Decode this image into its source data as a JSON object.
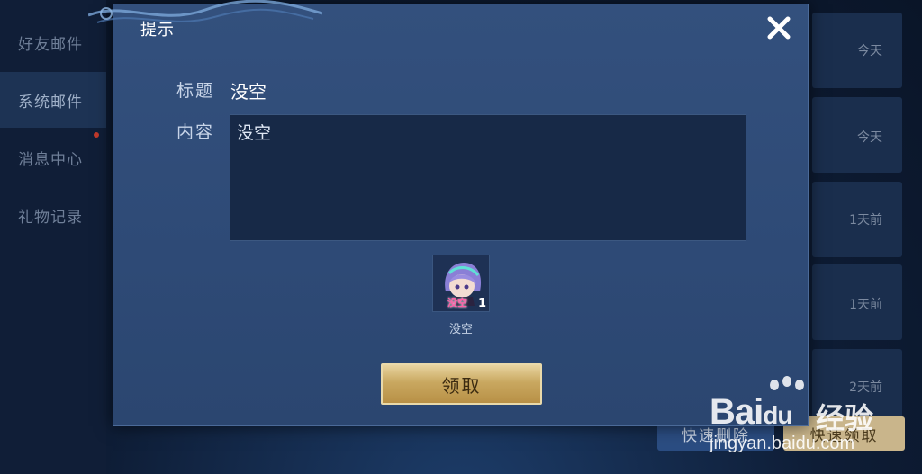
{
  "sidebar": {
    "items": [
      {
        "label": "好友邮件"
      },
      {
        "label": "系统邮件"
      },
      {
        "label": "消息中心"
      },
      {
        "label": "礼物记录"
      }
    ]
  },
  "mail_list": {
    "times": [
      "今天",
      "今天",
      "1天前",
      "1天前",
      "2天前"
    ]
  },
  "bottom_actions": {
    "delete_label": "快速删除",
    "claim_all_label": "快速领取"
  },
  "dialog": {
    "title": "提示",
    "close_icon": "close-icon",
    "subject_label": "标题",
    "subject_value": "没空",
    "content_label": "内容",
    "content_value": "没空",
    "attachment": {
      "tag_text": "没空",
      "count": "1",
      "name": "没空"
    },
    "claim_label": "领取"
  },
  "watermark": {
    "brand": "Bai",
    "brand_suffix": "du",
    "cn": "经验",
    "url": "jingyan.baidu.com"
  },
  "colors": {
    "modal_bg": "#33507d",
    "accent_gold": "#c9a860",
    "text_primary": "#ffffff"
  }
}
